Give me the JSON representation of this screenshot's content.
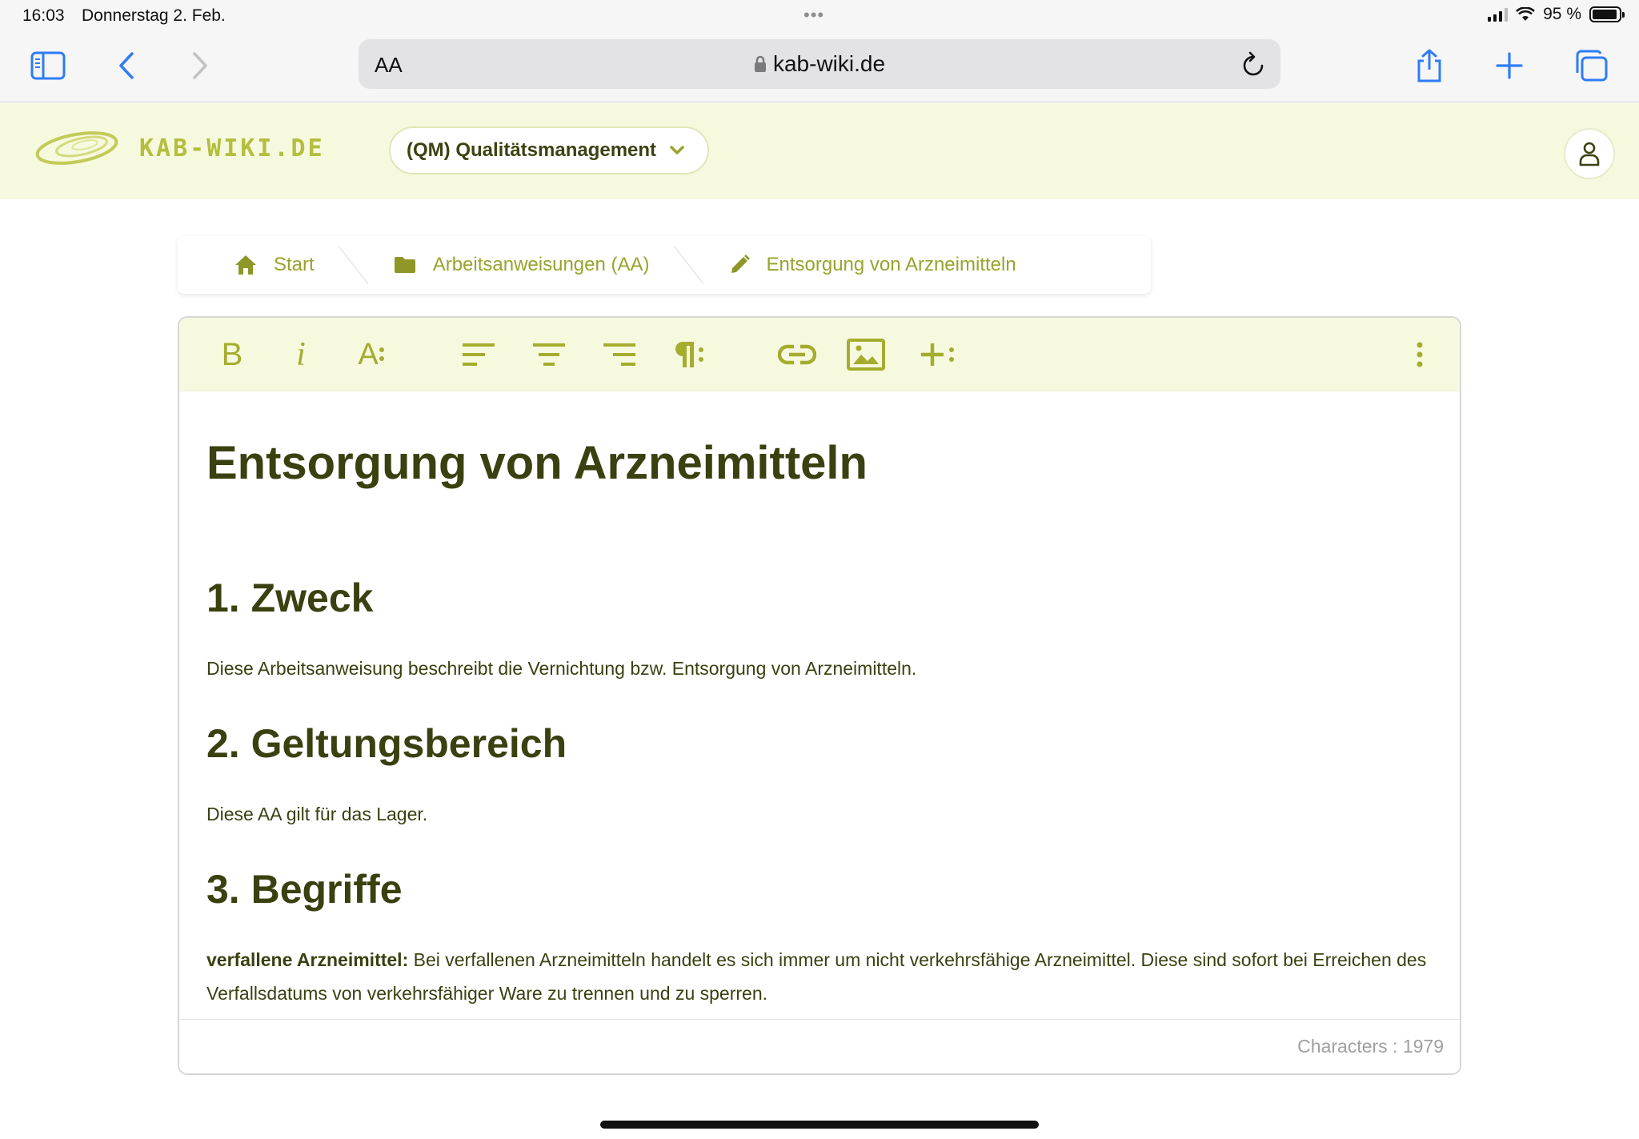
{
  "status": {
    "time": "16:03",
    "date": "Donnerstag 2. Feb.",
    "battery": "95 %",
    "battery_level": 0.95
  },
  "browser": {
    "aa_label": "AA",
    "url": "kab-wiki.de"
  },
  "header": {
    "logo_text": "KAB-WIKI.DE",
    "module_select": "(QM) Qualitätsmanagement",
    "accent_color": "#b3bf3d"
  },
  "breadcrumb": [
    {
      "label": "Start",
      "icon": "home-icon"
    },
    {
      "label": "Arbeitsanweisungen (AA)",
      "icon": "folder-icon"
    },
    {
      "label": "Entsorgung von Arzneimitteln",
      "icon": "pencil-icon"
    }
  ],
  "toolbar": {
    "bold": "B",
    "italic": "i",
    "font_size": "A"
  },
  "document": {
    "title": "Entsorgung von Arzneimitteln",
    "sections": [
      {
        "heading": "1. Zweck",
        "text": "Diese Arbeitsanweisung beschreibt die Vernichtung bzw. Entsorgung von Arzneimitteln."
      },
      {
        "heading": "2. Geltungsbereich",
        "text": "Diese AA gilt für das Lager."
      },
      {
        "heading": "3. Begriffe",
        "term": "verfallene Arzneimittel:",
        "text": " Bei verfallenen Arzneimitteln handelt es sich immer um nicht verkehrsfähige Arzneimittel. Diese sind sofort bei Erreichen des Verfallsdatums von verkehrsfähiger Ware zu trennen und zu sperren."
      }
    ]
  },
  "footer": {
    "char_count": "Characters : 1979"
  }
}
